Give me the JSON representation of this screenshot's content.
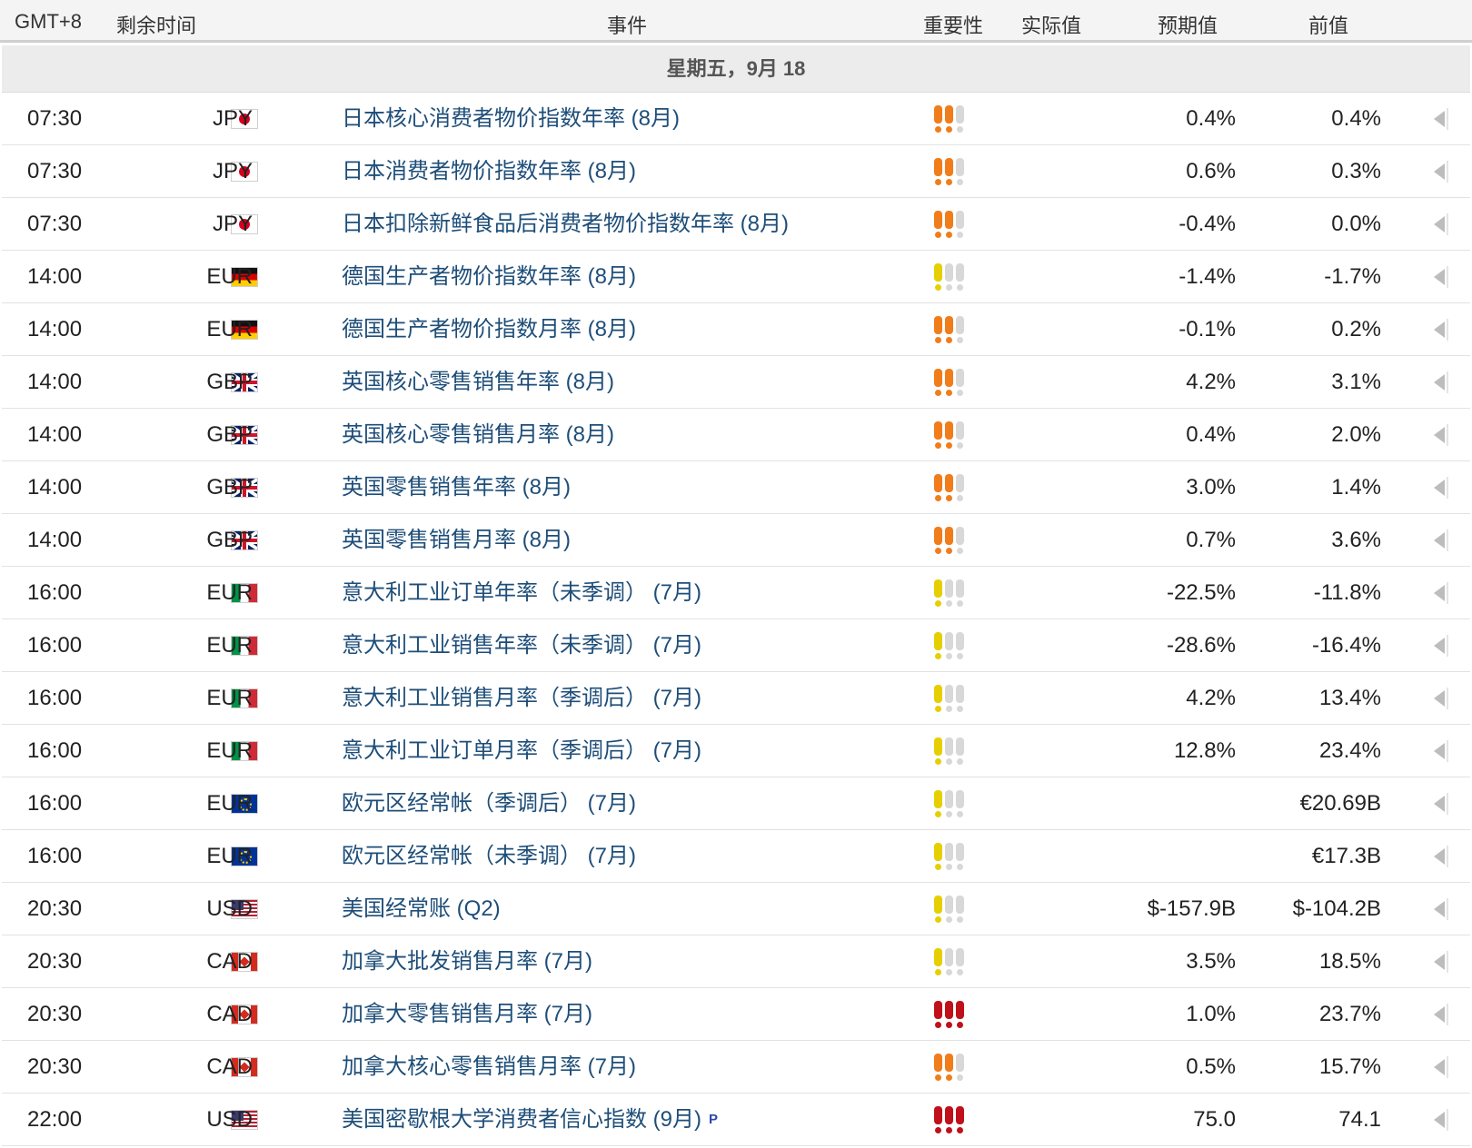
{
  "header": {
    "gmt": "GMT+8",
    "remaining": "剩余时间",
    "event": "事件",
    "importance": "重要性",
    "actual": "实际值",
    "forecast": "预期值",
    "previous": "前值"
  },
  "date_label": "星期五，9月 18",
  "colors": {
    "high": "#c0101a",
    "medium": "#f07d1a",
    "low": "#e6cf00",
    "inactive": "#d8d8d8",
    "event_link": "#1e4e79"
  },
  "events": [
    {
      "time": "07:30",
      "flag": "jp",
      "currency": "JPY",
      "event": "日本核心消费者物价指数年率 (8月)",
      "importance": 2,
      "actual": "",
      "forecast": "0.4%",
      "previous": "0.4%",
      "prelim": ""
    },
    {
      "time": "07:30",
      "flag": "jp",
      "currency": "JPY",
      "event": "日本消费者物价指数年率 (8月)",
      "importance": 2,
      "actual": "",
      "forecast": "0.6%",
      "previous": "0.3%",
      "prelim": ""
    },
    {
      "time": "07:30",
      "flag": "jp",
      "currency": "JPY",
      "event": "日本扣除新鲜食品后消费者物价指数年率 (8月)",
      "importance": 2,
      "actual": "",
      "forecast": "-0.4%",
      "previous": "0.0%",
      "prelim": ""
    },
    {
      "time": "14:00",
      "flag": "de",
      "currency": "EUR",
      "event": "德国生产者物价指数年率 (8月)",
      "importance": 1,
      "actual": "",
      "forecast": "-1.4%",
      "previous": "-1.7%",
      "prelim": ""
    },
    {
      "time": "14:00",
      "flag": "de",
      "currency": "EUR",
      "event": "德国生产者物价指数月率 (8月)",
      "importance": 2,
      "actual": "",
      "forecast": "-0.1%",
      "previous": "0.2%",
      "prelim": ""
    },
    {
      "time": "14:00",
      "flag": "gb",
      "currency": "GBP",
      "event": "英国核心零售销售年率 (8月)",
      "importance": 2,
      "actual": "",
      "forecast": "4.2%",
      "previous": "3.1%",
      "prelim": ""
    },
    {
      "time": "14:00",
      "flag": "gb",
      "currency": "GBP",
      "event": "英国核心零售销售月率 (8月)",
      "importance": 2,
      "actual": "",
      "forecast": "0.4%",
      "previous": "2.0%",
      "prelim": ""
    },
    {
      "time": "14:00",
      "flag": "gb",
      "currency": "GBP",
      "event": "英国零售销售年率 (8月)",
      "importance": 2,
      "actual": "",
      "forecast": "3.0%",
      "previous": "1.4%",
      "prelim": ""
    },
    {
      "time": "14:00",
      "flag": "gb",
      "currency": "GBP",
      "event": "英国零售销售月率 (8月)",
      "importance": 2,
      "actual": "",
      "forecast": "0.7%",
      "previous": "3.6%",
      "prelim": ""
    },
    {
      "time": "16:00",
      "flag": "it",
      "currency": "EUR",
      "event": "意大利工业订单年率（未季调） (7月)",
      "importance": 1,
      "actual": "",
      "forecast": "-22.5%",
      "previous": "-11.8%",
      "prelim": ""
    },
    {
      "time": "16:00",
      "flag": "it",
      "currency": "EUR",
      "event": "意大利工业销售年率（未季调） (7月)",
      "importance": 1,
      "actual": "",
      "forecast": "-28.6%",
      "previous": "-16.4%",
      "prelim": ""
    },
    {
      "time": "16:00",
      "flag": "it",
      "currency": "EUR",
      "event": "意大利工业销售月率（季调后） (7月)",
      "importance": 1,
      "actual": "",
      "forecast": "4.2%",
      "previous": "13.4%",
      "prelim": ""
    },
    {
      "time": "16:00",
      "flag": "it",
      "currency": "EUR",
      "event": "意大利工业订单月率（季调后） (7月)",
      "importance": 1,
      "actual": "",
      "forecast": "12.8%",
      "previous": "23.4%",
      "prelim": ""
    },
    {
      "time": "16:00",
      "flag": "eu",
      "currency": "EUR",
      "event": "欧元区经常帐（季调后） (7月)",
      "importance": 1,
      "actual": "",
      "forecast": "",
      "previous": "€20.69B",
      "prelim": ""
    },
    {
      "time": "16:00",
      "flag": "eu",
      "currency": "EUR",
      "event": "欧元区经常帐（未季调） (7月)",
      "importance": 1,
      "actual": "",
      "forecast": "",
      "previous": "€17.3B",
      "prelim": ""
    },
    {
      "time": "20:30",
      "flag": "us",
      "currency": "USD",
      "event": "美国经常账 (Q2)",
      "importance": 1,
      "actual": "",
      "forecast": "$-157.9B",
      "previous": "$-104.2B",
      "prelim": ""
    },
    {
      "time": "20:30",
      "flag": "ca",
      "currency": "CAD",
      "event": "加拿大批发销售月率 (7月)",
      "importance": 1,
      "actual": "",
      "forecast": "3.5%",
      "previous": "18.5%",
      "prelim": ""
    },
    {
      "time": "20:30",
      "flag": "ca",
      "currency": "CAD",
      "event": "加拿大零售销售月率 (7月)",
      "importance": 3,
      "actual": "",
      "forecast": "1.0%",
      "previous": "23.7%",
      "prelim": ""
    },
    {
      "time": "20:30",
      "flag": "ca",
      "currency": "CAD",
      "event": "加拿大核心零售销售月率 (7月)",
      "importance": 2,
      "actual": "",
      "forecast": "0.5%",
      "previous": "15.7%",
      "prelim": ""
    },
    {
      "time": "22:00",
      "flag": "us",
      "currency": "USD",
      "event": "美国密歇根大学消费者信心指数 (9月)",
      "importance": 3,
      "actual": "",
      "forecast": "75.0",
      "previous": "74.1",
      "prelim": "P"
    }
  ]
}
